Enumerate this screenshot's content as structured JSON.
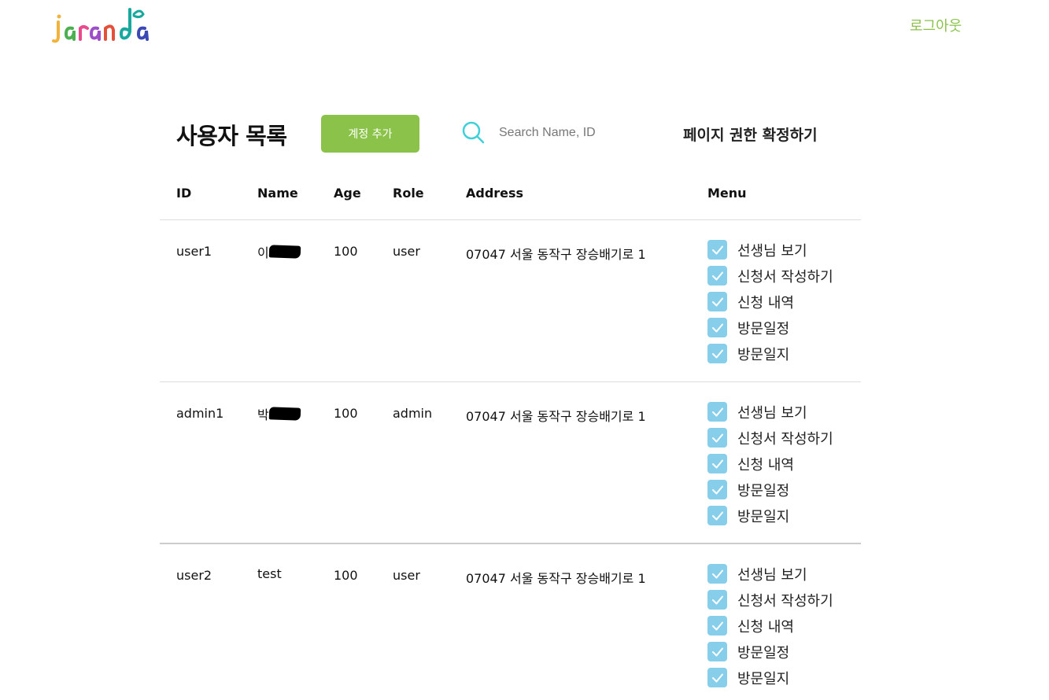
{
  "header": {
    "logo_text": "jaranda",
    "logout_label": "로그아웃"
  },
  "toolbar": {
    "title": "사용자 목록",
    "add_label": "계정 추가",
    "search_placeholder": "Search Name, ID",
    "confirm_label": "페이지 권한 확정하기"
  },
  "table": {
    "columns": [
      "ID",
      "Name",
      "Age",
      "Role",
      "Address",
      "Menu"
    ],
    "rows": [
      {
        "id": "user1",
        "name": "이",
        "name_redacted": true,
        "age": "100",
        "role": "user",
        "address": "07047 서울 동작구 장승배기로 1",
        "menu": [
          "선생님 보기",
          "신청서 작성하기",
          "신청 내역",
          "방문일정",
          "방문일지"
        ],
        "menu_checked": [
          true,
          true,
          true,
          true,
          true
        ]
      },
      {
        "id": "admin1",
        "name": "박",
        "name_redacted": true,
        "age": "100",
        "role": "admin",
        "address": "07047 서울 동작구 장승배기로 1",
        "menu": [
          "선생님 보기",
          "신청서 작성하기",
          "신청 내역",
          "방문일정",
          "방문일지"
        ],
        "menu_checked": [
          true,
          true,
          true,
          true,
          true
        ]
      },
      {
        "id": "user2",
        "name": "test",
        "name_redacted": false,
        "age": "100",
        "role": "user",
        "address": "07047 서울 동작구 장승배기로 1",
        "menu": [
          "선생님 보기",
          "신청서 작성하기",
          "신청 내역",
          "방문일정",
          "방문일지"
        ],
        "menu_checked": [
          true,
          true,
          true,
          true,
          true
        ]
      }
    ]
  },
  "colors": {
    "accent_green": "#8bc34a",
    "checkbox_blue": "#87ceeb",
    "search_icon": "#3fd0d9"
  }
}
